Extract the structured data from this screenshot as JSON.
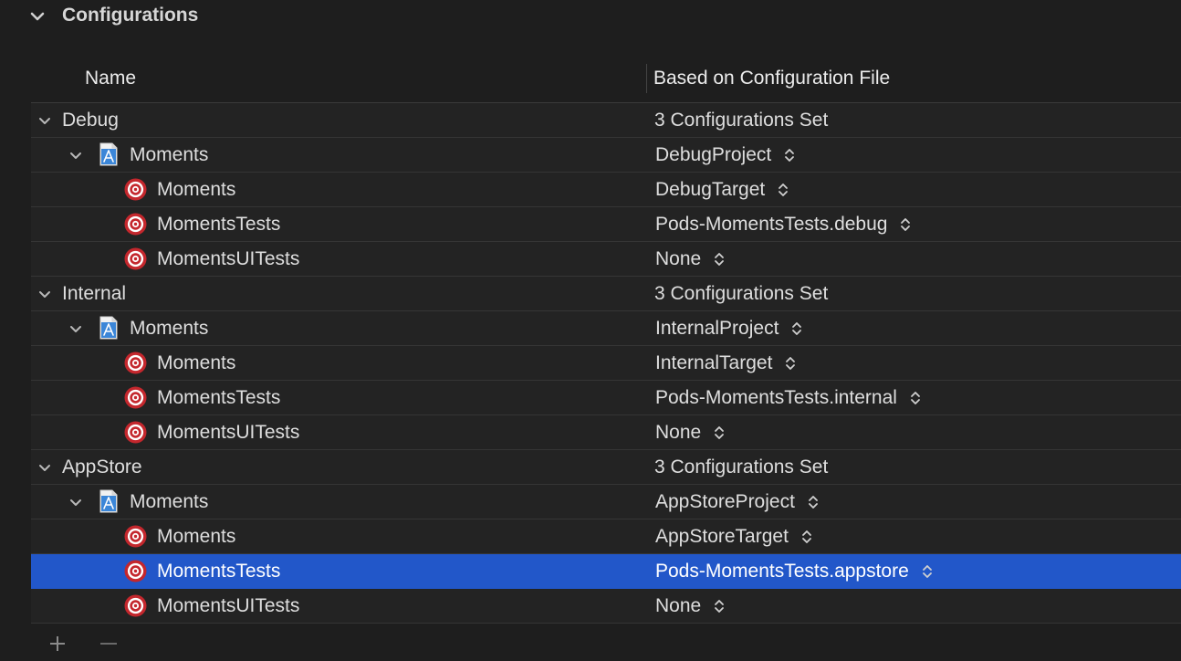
{
  "section": {
    "title": "Configurations"
  },
  "columns": {
    "name": "Name",
    "file": "Based on Configuration File"
  },
  "rows": [
    {
      "level": 0,
      "kind": "config",
      "name": "Debug",
      "value": "3 Configurations Set"
    },
    {
      "level": 1,
      "kind": "project",
      "name": "Moments",
      "value": "DebugProject",
      "popup": true
    },
    {
      "level": 2,
      "kind": "target",
      "name": "Moments",
      "value": "DebugTarget",
      "popup": true
    },
    {
      "level": 2,
      "kind": "target",
      "name": "MomentsTests",
      "value": "Pods-MomentsTests.debug",
      "popup": true
    },
    {
      "level": 2,
      "kind": "target",
      "name": "MomentsUITests",
      "value": "None",
      "popup": true
    },
    {
      "level": 0,
      "kind": "config",
      "name": "Internal",
      "value": "3 Configurations Set"
    },
    {
      "level": 1,
      "kind": "project",
      "name": "Moments",
      "value": "InternalProject",
      "popup": true
    },
    {
      "level": 2,
      "kind": "target",
      "name": "Moments",
      "value": "InternalTarget",
      "popup": true
    },
    {
      "level": 2,
      "kind": "target",
      "name": "MomentsTests",
      "value": "Pods-MomentsTests.internal",
      "popup": true
    },
    {
      "level": 2,
      "kind": "target",
      "name": "MomentsUITests",
      "value": "None",
      "popup": true
    },
    {
      "level": 0,
      "kind": "config",
      "name": "AppStore",
      "value": "3 Configurations Set"
    },
    {
      "level": 1,
      "kind": "project",
      "name": "Moments",
      "value": "AppStoreProject",
      "popup": true
    },
    {
      "level": 2,
      "kind": "target",
      "name": "Moments",
      "value": "AppStoreTarget",
      "popup": true
    },
    {
      "level": 2,
      "kind": "target",
      "name": "MomentsTests",
      "value": "Pods-MomentsTests.appstore",
      "popup": true,
      "selected": true
    },
    {
      "level": 2,
      "kind": "target",
      "name": "MomentsUITests",
      "value": "None",
      "popup": true
    }
  ],
  "icons": {
    "disclosure": "chevron-down-icon",
    "project": "xcode-project-icon",
    "target": "target-icon",
    "popup": "up-down-arrows-icon",
    "add": "plus-icon",
    "remove": "minus-icon"
  },
  "colors": {
    "background": "#1e1e1e",
    "row": "#232323",
    "selection": "#2257c9",
    "target_red": "#c4272d",
    "project_blue": "#3b86d8"
  }
}
